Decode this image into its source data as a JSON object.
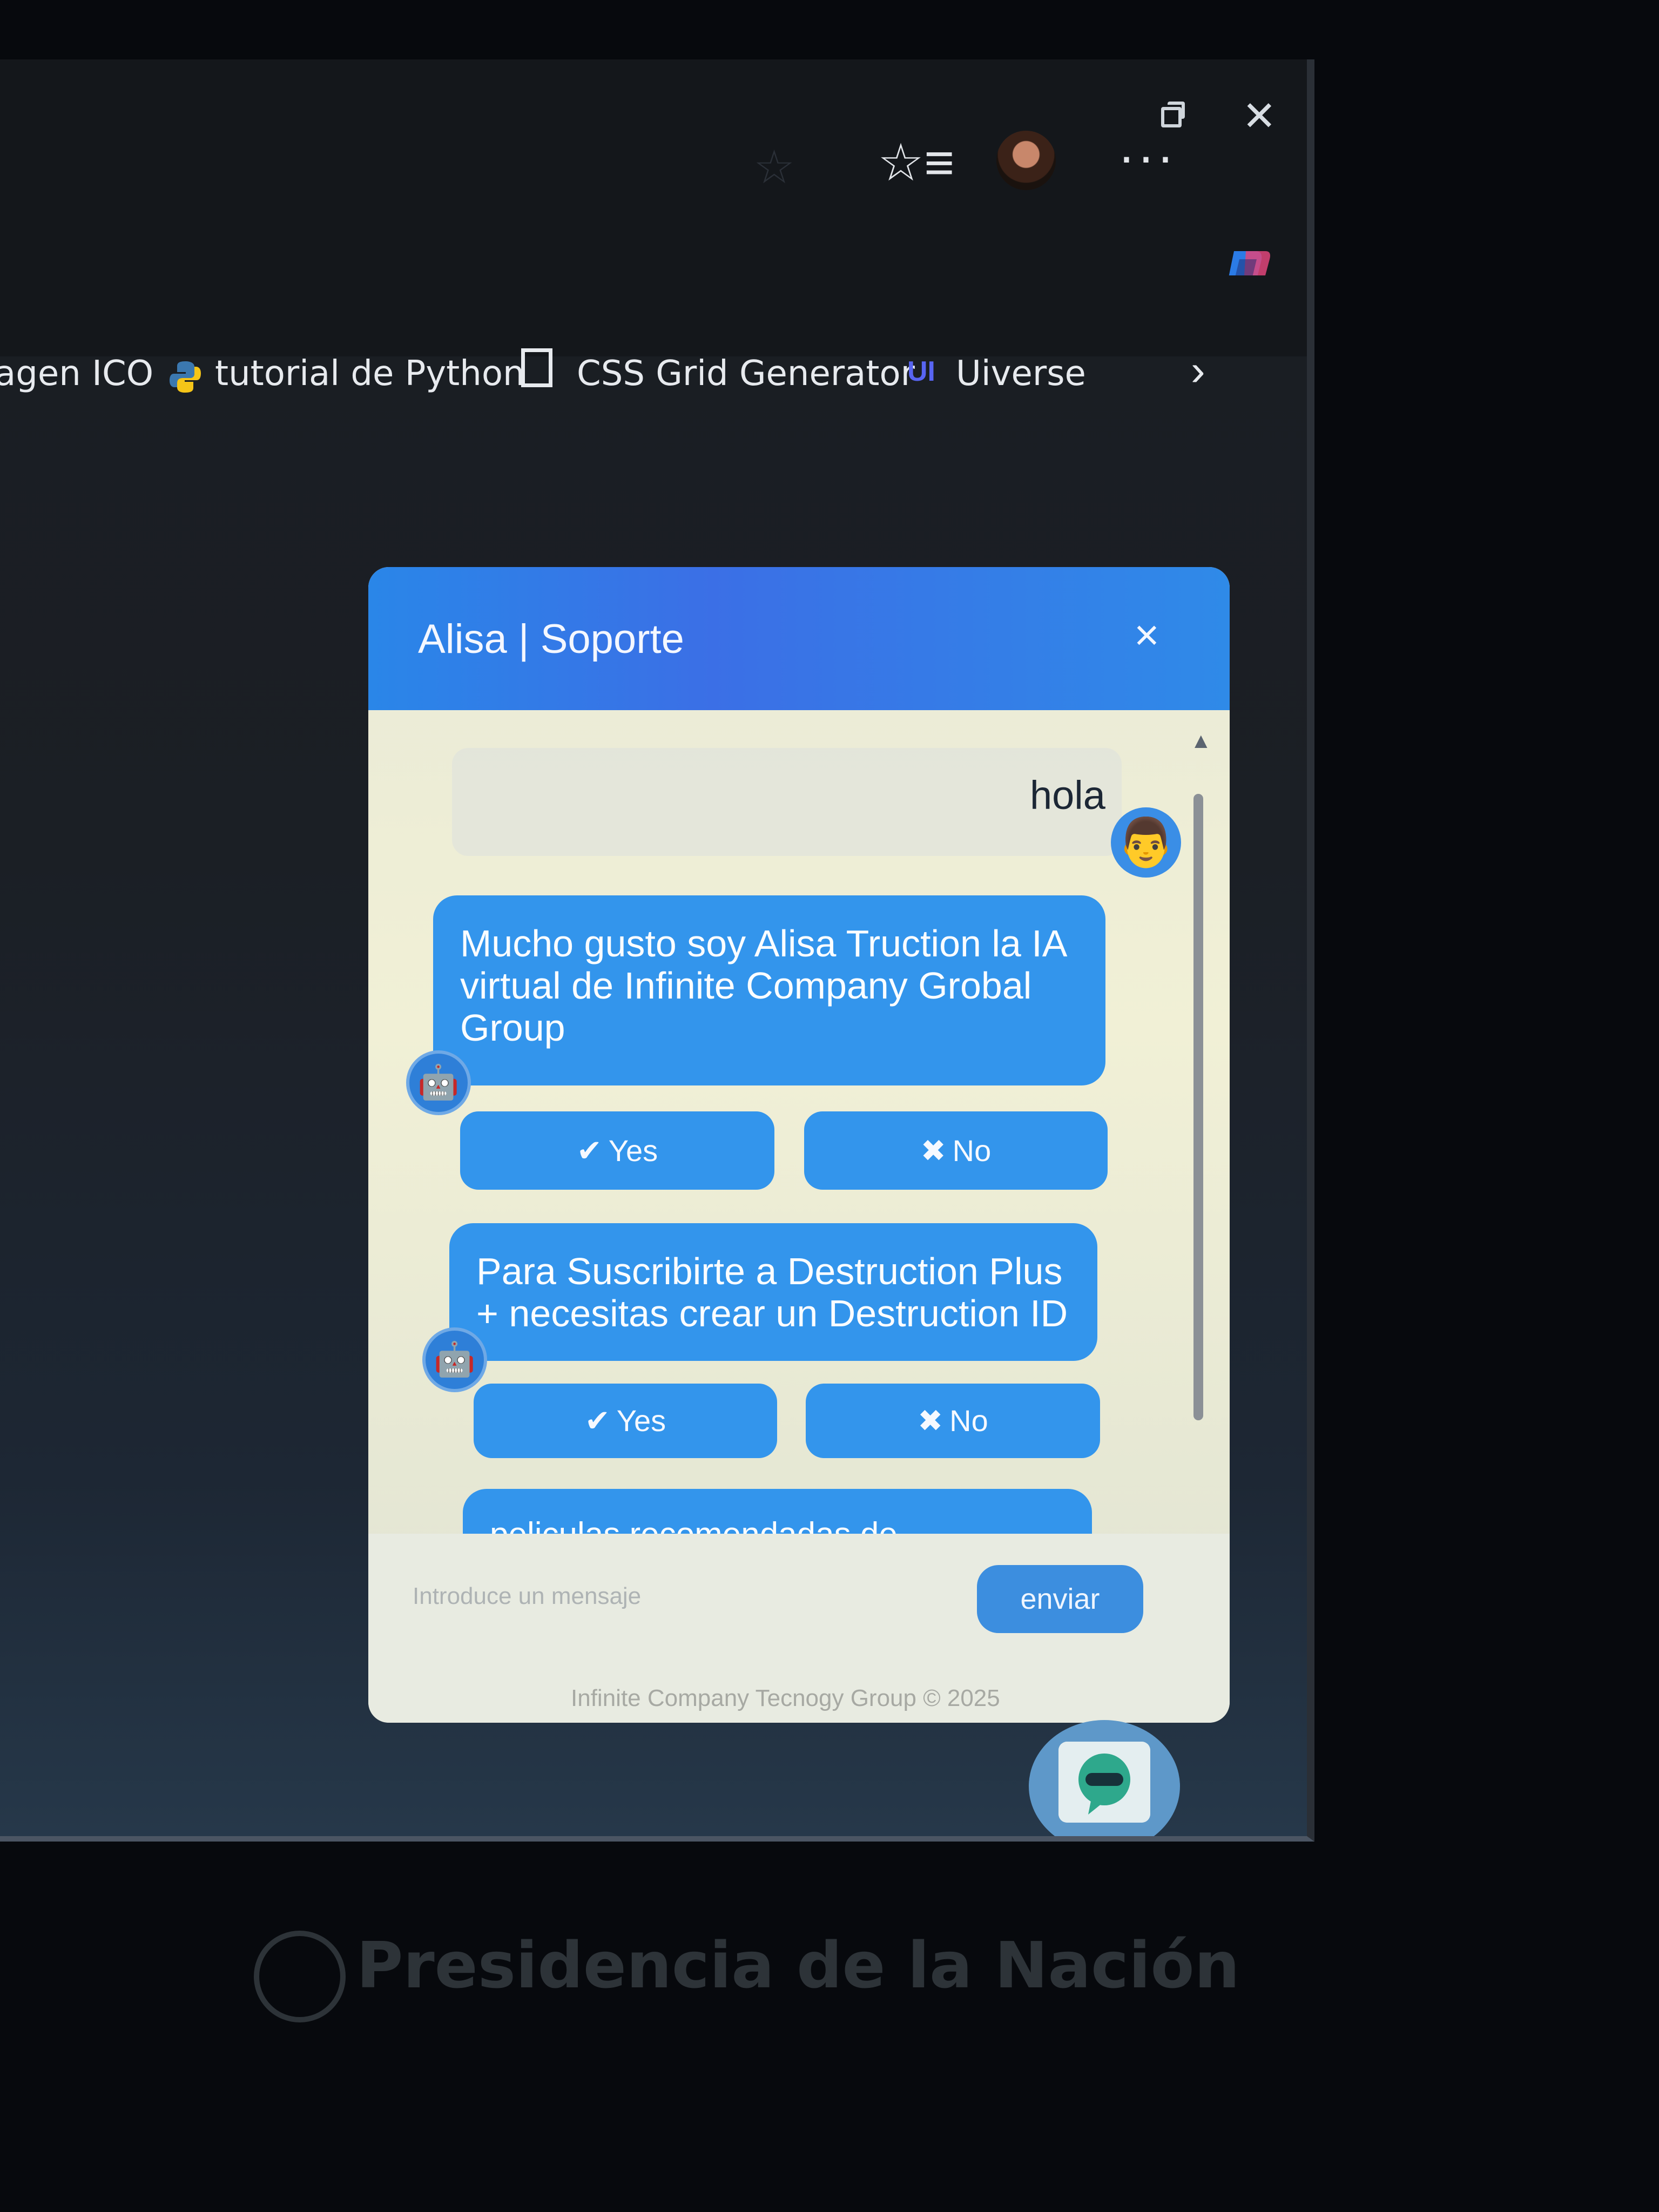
{
  "browser": {
    "bookmarks": [
      {
        "label": "agen ICO"
      },
      {
        "label": "tutorial de Python"
      },
      {
        "label": "CSS Grid Generator"
      },
      {
        "label": "Uiverse"
      }
    ],
    "icons": {
      "restore": "restore-window-icon",
      "close": "close-window-icon",
      "favorites": "favorites-icon",
      "more": "more-icon",
      "copilot": "copilot-icon"
    }
  },
  "chat": {
    "title": "Alisa | Soporte",
    "close_symbol": "×",
    "user_message": "hola",
    "user_avatar": "👨",
    "bot_avatar": "🤖",
    "messages": [
      {
        "text": "Mucho gusto soy Alisa Truction la IA virtual de Infinite Company Grobal Group",
        "yes": "Yes",
        "no": "No"
      },
      {
        "text": "Para Suscribirte a Destruction Plus + necesitas crear un Destruction ID",
        "yes": "Yes",
        "no": "No"
      },
      {
        "text": "peliculas recomendadas de Destruction Plus + son Pretty Cure"
      }
    ],
    "yes_symbol": "✔",
    "no_symbol": "✖",
    "input_placeholder": "Introduce un mensaje",
    "send_label": "enviar",
    "footer": "Infinite Company Tecnogy Group © 2025",
    "accent_color": "#3395ec"
  },
  "monitor": {
    "brand": "Presidencia de la Nación"
  }
}
